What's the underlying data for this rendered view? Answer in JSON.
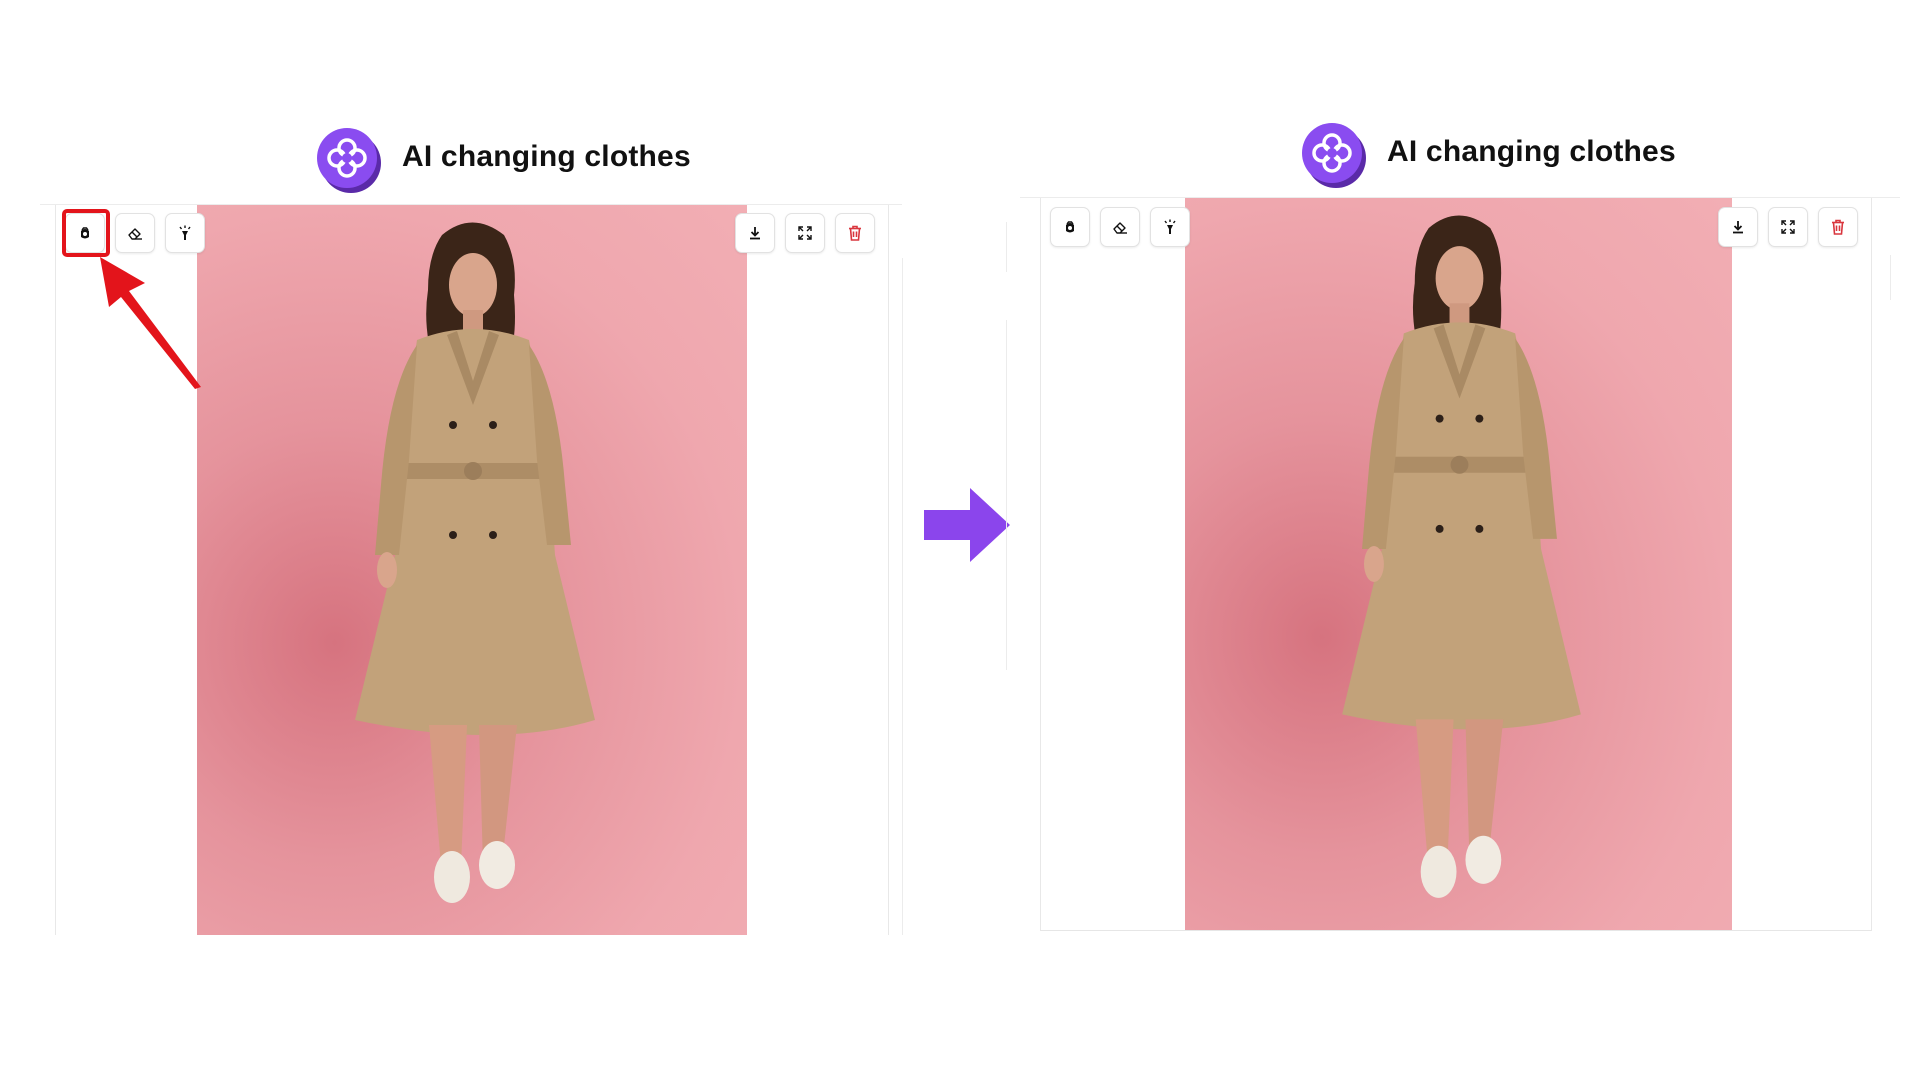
{
  "panels": [
    {
      "id": "before",
      "app_title": "AI changing clothes",
      "toolbar_left": [
        {
          "icon": "clothes-swap-icon"
        },
        {
          "icon": "eraser-icon"
        },
        {
          "icon": "magic-wand-icon"
        }
      ],
      "toolbar_right": [
        {
          "icon": "download-icon"
        },
        {
          "icon": "fullscreen-icon"
        },
        {
          "icon": "trash-icon"
        }
      ],
      "highlighted_tool": "clothes-swap-icon"
    },
    {
      "id": "after",
      "app_title": "AI changing clothes",
      "toolbar_left": [
        {
          "icon": "clothes-swap-icon"
        },
        {
          "icon": "eraser-icon"
        },
        {
          "icon": "magic-wand-icon"
        }
      ],
      "toolbar_right": [
        {
          "icon": "download-icon"
        },
        {
          "icon": "fullscreen-icon"
        },
        {
          "icon": "trash-icon"
        }
      ]
    }
  ],
  "colors": {
    "brand_purple": "#7b3fe4",
    "highlight_red": "#e3141b",
    "flow_arrow": "#8b45ec",
    "trash_red": "#d9363e",
    "photo_background": "#eea3aa",
    "coat": "#c2a27a"
  }
}
